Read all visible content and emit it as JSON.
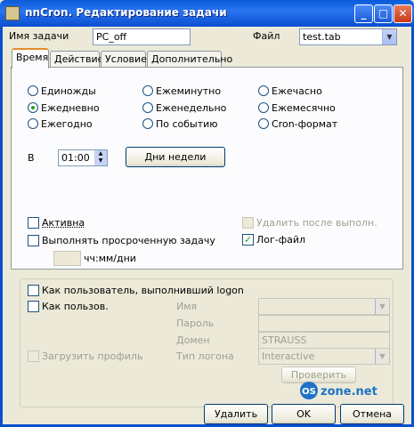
{
  "window": {
    "title": "nnCron. Редактирование задачи",
    "minimize": "_",
    "maximize": "□",
    "close": "✕"
  },
  "header": {
    "task_name_label": "Имя задачи",
    "task_name_value": "PC_off",
    "file_label": "Файл",
    "file_value": "test.tab"
  },
  "tabs": [
    {
      "label": "Время",
      "active": true
    },
    {
      "label": "Действие"
    },
    {
      "label": "Условие"
    },
    {
      "label": "Дополнительно"
    }
  ],
  "schedule": {
    "options": [
      {
        "label": "Единожды",
        "checked": false
      },
      {
        "label": "Ежеминутно",
        "checked": false
      },
      {
        "label": "Ежечасно",
        "checked": false
      },
      {
        "label": "Ежедневно",
        "checked": true
      },
      {
        "label": "Еженедельно",
        "checked": false
      },
      {
        "label": "Ежемесячно",
        "checked": false
      },
      {
        "label": "Ежегодно",
        "checked": false
      },
      {
        "label": "По событию",
        "checked": false
      },
      {
        "label": "Cron-формат",
        "checked": false
      }
    ],
    "at_label": "В",
    "time_value": "01:00",
    "weekdays_button": "Дни недели"
  },
  "flags": {
    "active_label": "Активна",
    "active_checked": false,
    "missed_label": "Выполнять просроченную задачу",
    "missed_checked": false,
    "missed_format": "чч:мм/дни",
    "delete_after_label": "Удалить после выполн.",
    "log_label": "Лог-файл",
    "log_checked": true
  },
  "user": {
    "as_logon_label": "Как пользователь, выполнивший logon",
    "as_user_label": "Как пользов.",
    "name_label": "Имя",
    "password_label": "Пароль",
    "domain_label": "Домен",
    "domain_value": "STRAUSS",
    "logon_type_label": "Тип логона",
    "logon_type_value": "Interactive",
    "load_profile_label": "Загрузить профиль",
    "check_button": "Проверить"
  },
  "footer": {
    "delete_button": "Удалить",
    "ok_button": "OK",
    "cancel_button": "Отмена"
  },
  "watermark": {
    "brand_a": "OS",
    "brand_b": "zone.net"
  },
  "colors": {
    "titlebar": "#0a5ad9",
    "tab_accent": "#e68b2c",
    "check_mark": "#21a121",
    "logo_blue": "#1e73c8"
  }
}
